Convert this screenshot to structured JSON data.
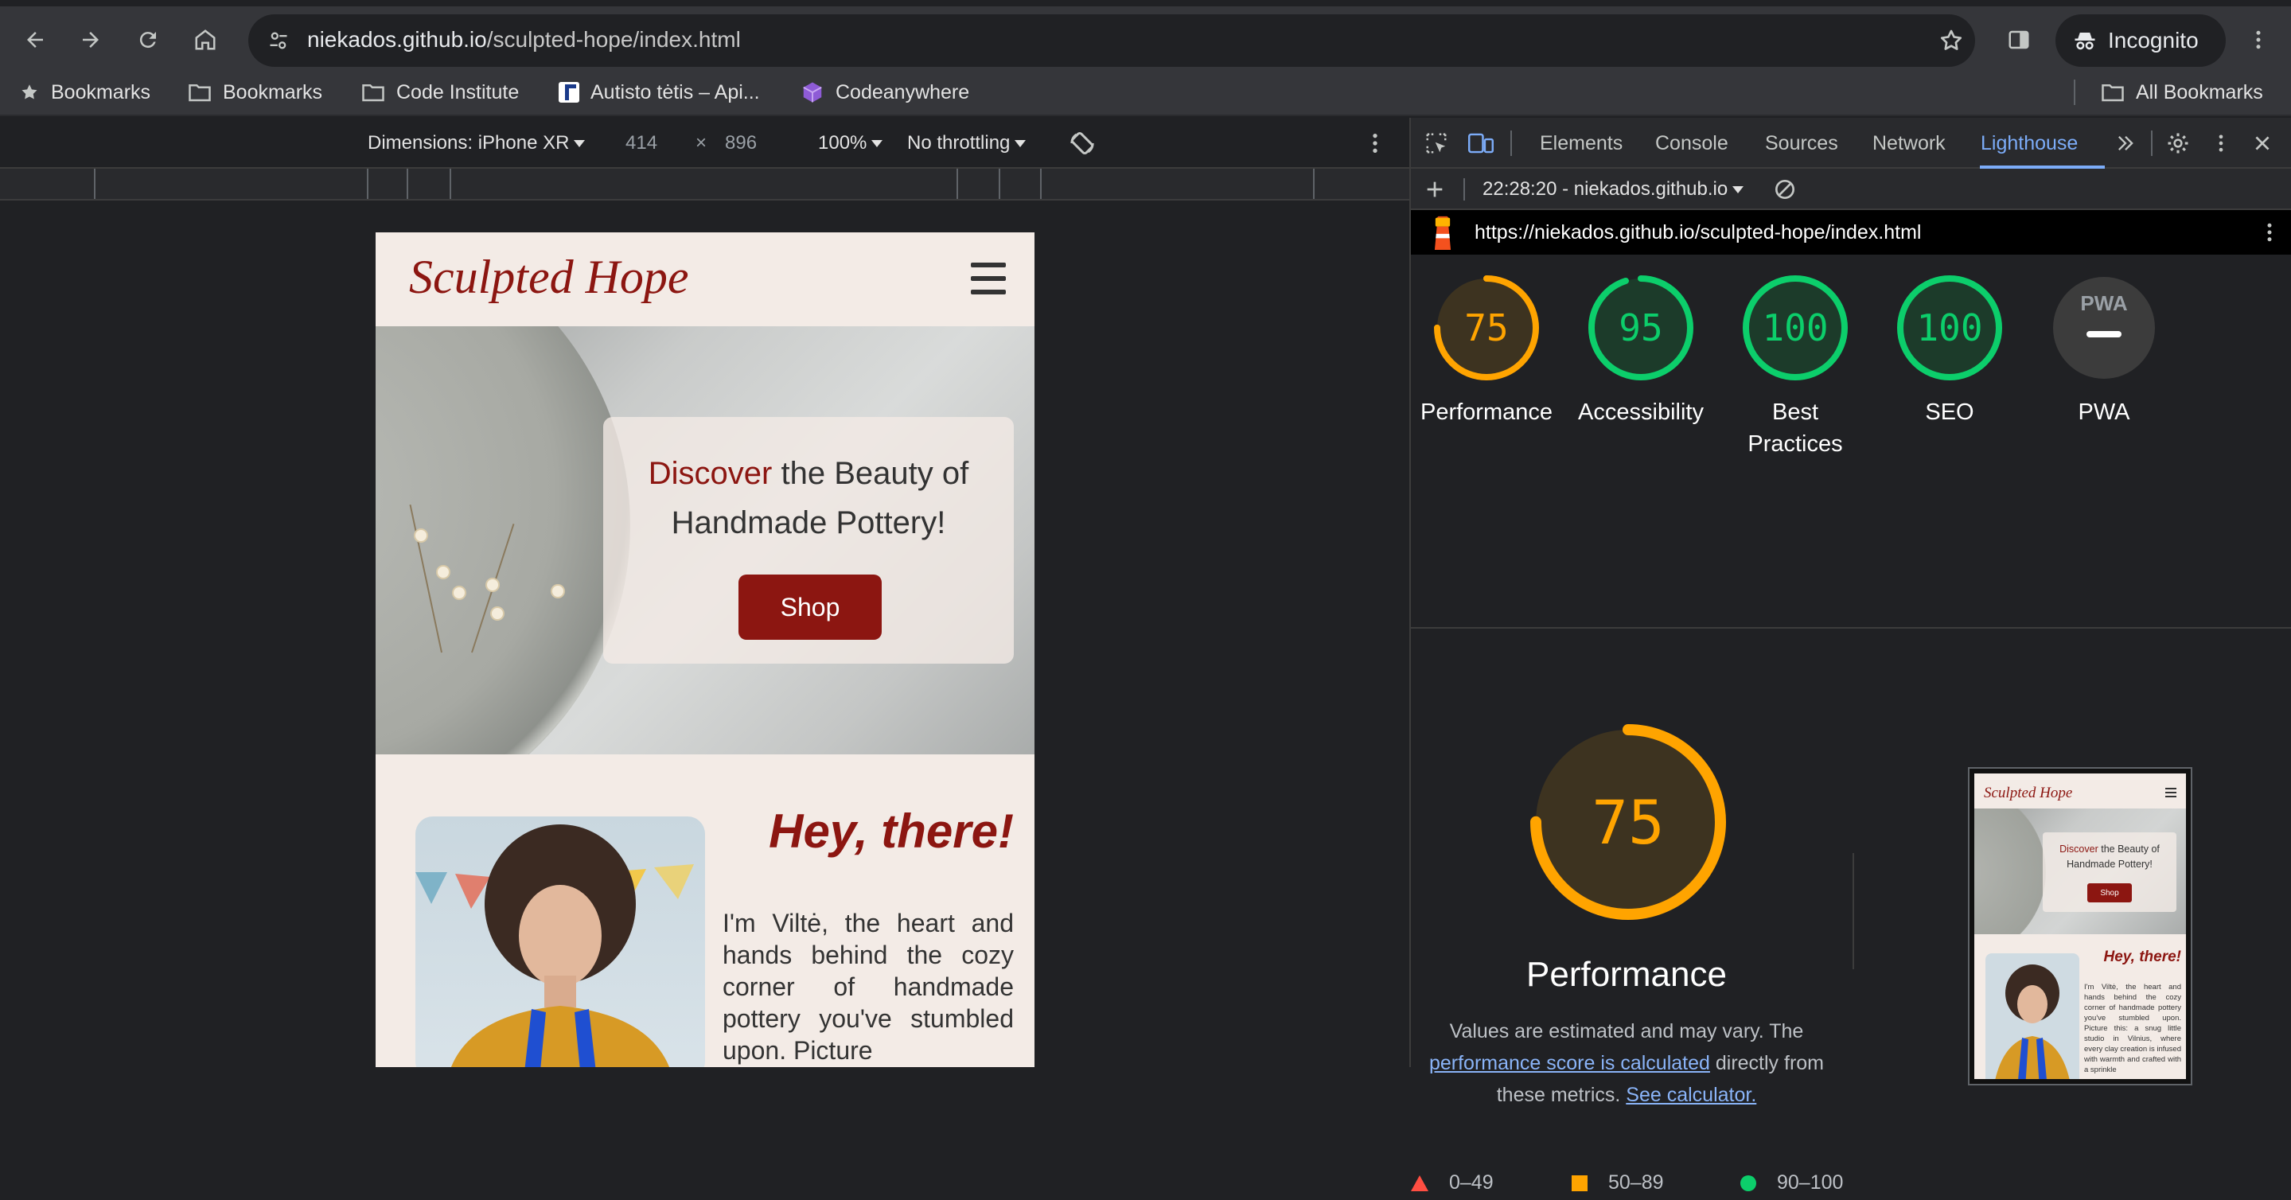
{
  "browser": {
    "url_host": "niekados.github.io",
    "url_path": "/sculpted-hope/index.html",
    "profile_label": "Incognito"
  },
  "bookmarks_bar": {
    "items": [
      {
        "label": "Bookmarks",
        "icon": "star-icon"
      },
      {
        "label": "Bookmarks",
        "icon": "folder-icon"
      },
      {
        "label": "Code Institute",
        "icon": "folder-icon"
      },
      {
        "label": "Autisto tėtis – Api...",
        "icon": "site-favicon"
      },
      {
        "label": "Codeanywhere",
        "icon": "cube-icon"
      }
    ],
    "all_bookmarks": "All Bookmarks"
  },
  "device_toolbar": {
    "dimensions_label": "Dimensions: iPhone XR",
    "width": "414",
    "times": "×",
    "height": "896",
    "zoom": "100%",
    "throttling": "No throttling"
  },
  "devtools": {
    "tabs": [
      "Elements",
      "Console",
      "Sources",
      "Network",
      "Lighthouse"
    ],
    "active_tab": "Lighthouse",
    "report_selector": "22:28:20 - niekados.github.io",
    "report_url": "https://niekados.github.io/sculpted-hope/index.html"
  },
  "lighthouse": {
    "scores": [
      {
        "label": "Performance",
        "value": "75",
        "score": 75,
        "color": "#ffa400"
      },
      {
        "label": "Accessibility",
        "value": "95",
        "score": 95,
        "color": "#0cce6b"
      },
      {
        "label": "Best Practices",
        "value": "100",
        "score": 100,
        "color": "#0cce6b"
      },
      {
        "label": "SEO",
        "value": "100",
        "score": 100,
        "color": "#0cce6b"
      },
      {
        "label": "PWA",
        "value": "PWA",
        "score": null,
        "color": "#9aa0a6"
      }
    ],
    "detail": {
      "score": "75",
      "score_value": 75,
      "title": "Performance",
      "desc_before": "Values are estimated and may vary. The",
      "desc_link": "performance score is calculated",
      "desc_after": "directly from these metrics.",
      "calculator_link": "See calculator."
    },
    "legend": [
      {
        "range": "0–49",
        "color": "#ff4e42",
        "shape": "triangle"
      },
      {
        "range": "50–89",
        "color": "#ffa400",
        "shape": "square"
      },
      {
        "range": "90–100",
        "color": "#0cce6b",
        "shape": "circle"
      }
    ]
  },
  "site": {
    "logo": "Sculpted Hope",
    "hero_accent": "Discover",
    "hero_rest": "the Beauty of Handmade Pottery!",
    "shop_button": "Shop",
    "about_heading": "Hey, there!",
    "about_text": "I'm Viltė, the heart and hands behind the cozy corner of handmade pottery you've stumbled upon. Picture"
  },
  "thumbnail": {
    "logo": "Sculpted Hope",
    "hero_accent": "Discover",
    "hero_rest": "the Beauty of Handmade Pottery!",
    "shop_button": "Shop",
    "about_heading": "Hey, there!",
    "about_text": "I'm Viltė, the heart and hands behind the cozy corner of handmade pottery you've stumbled upon. Picture this: a snug little studio in Vilnius, where every clay creation is infused with warmth and crafted with a sprinkle"
  }
}
